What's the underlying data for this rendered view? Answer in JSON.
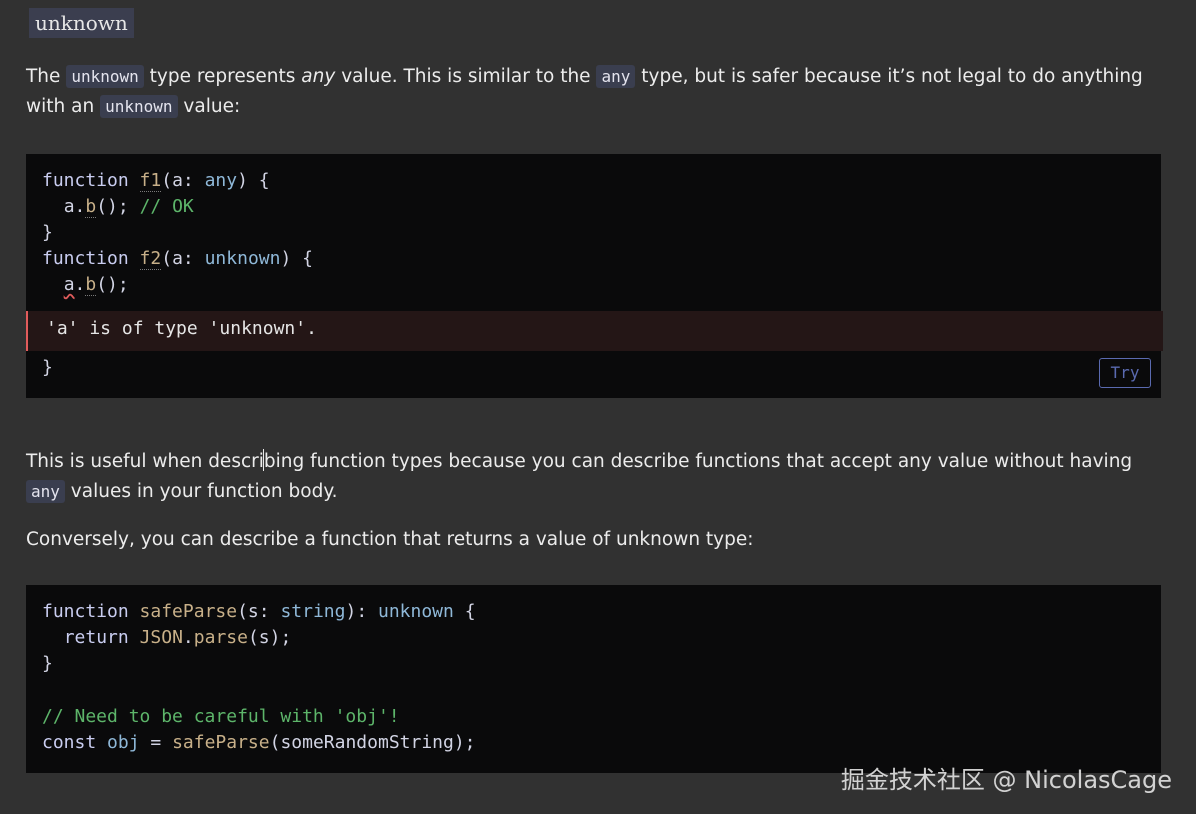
{
  "heading": "unknown",
  "intro": {
    "part1": "The",
    "code1": "unknown",
    "part2": "type represents",
    "em": "any",
    "part3": "value. This is similar to the",
    "code2": "any",
    "part4": "type, but is safer because it’s not legal to do anything with an",
    "code3": "unknown",
    "part5": "value:"
  },
  "code1": {
    "lines": [
      [
        "function",
        "f1",
        "(a: ",
        "any",
        ") {"
      ],
      [
        "a",
        ".",
        "b",
        "(); ",
        "// OK"
      ],
      [
        "}"
      ],
      [
        "function",
        "f2",
        "(a: ",
        "unknown",
        ") {"
      ],
      [
        "a",
        ".",
        "b",
        "();"
      ],
      [
        "}"
      ]
    ],
    "error": "'a' is of type 'unknown'.",
    "try_label": "Try"
  },
  "para2": {
    "text_before": "This is useful when descri",
    "text_after": "bing function types because you can describe functions that accept any value without having",
    "code": "any",
    "text_end": "values in your function body."
  },
  "para3": "Conversely, you can describe a function that returns a value of unknown type:",
  "code2": {
    "l1_kw": "function",
    "l1_fn": "safeParse",
    "l1_a": "(s: ",
    "l1_t": "string",
    "l1_b": "): ",
    "l1_t2": "unknown",
    "l1_c": " {",
    "l2_kw": "return",
    "l2_obj": "JSON",
    "l2_dot": ".",
    "l2_fn": "parse",
    "l2_rest": "(s);",
    "l3": "}",
    "l5": "// Need to be careful with 'obj'!",
    "l6_kw": "const",
    "l6_var": "obj",
    "l6_eq": " = ",
    "l6_fn": "safeParse",
    "l6_rest": "(someRandomString);"
  },
  "watermark": "掘金技术社区 @ NicolasCage"
}
